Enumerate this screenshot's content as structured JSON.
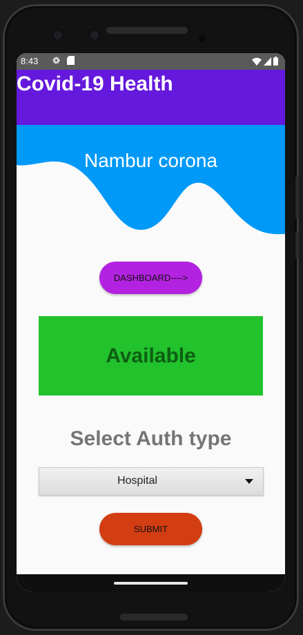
{
  "status_bar": {
    "time": "8:43",
    "icons_left": [
      "gear-icon",
      "sd-card-icon"
    ],
    "icons_right": [
      "wifi-icon",
      "signal-icon",
      "battery-icon"
    ]
  },
  "app_bar": {
    "title": "Covid-19 Health",
    "color": "#6519dc"
  },
  "header_wave": {
    "title": "Nambur corona",
    "color": "#0099f7"
  },
  "dashboard_button": {
    "label": "DASHBOARD---->",
    "color": "#b322e0"
  },
  "status_box": {
    "label": "Available",
    "color": "#22c22d"
  },
  "auth_section": {
    "heading": "Select Auth type",
    "dropdown_value": "Hospital"
  },
  "submit_button": {
    "label": "SUBMIT",
    "color": "#d33d12"
  }
}
